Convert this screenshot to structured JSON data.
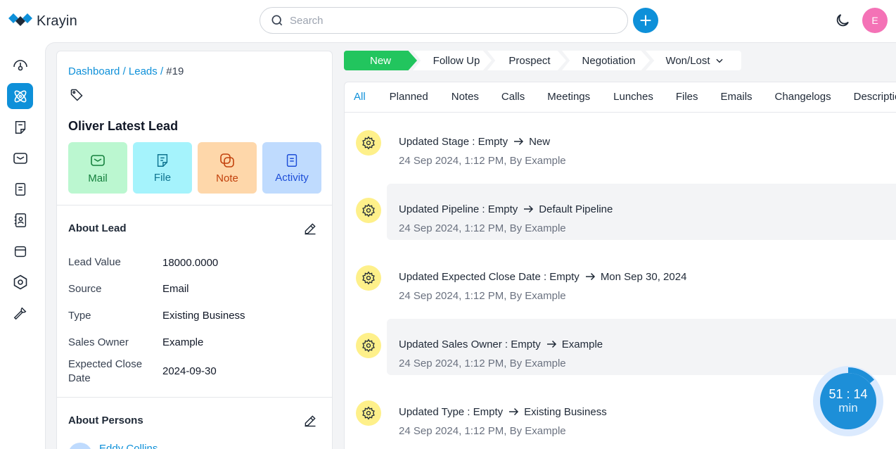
{
  "app": {
    "name": "Krayin"
  },
  "search": {
    "placeholder": "Search"
  },
  "user": {
    "avatar_initial": "E"
  },
  "sidebar": {
    "items": [
      {
        "name": "dashboard",
        "icon": "gauge-icon",
        "active": false
      },
      {
        "name": "leads",
        "icon": "atom-icon",
        "active": true
      },
      {
        "name": "quotes",
        "icon": "sticky-note-icon",
        "active": false
      },
      {
        "name": "mail",
        "icon": "mail-icon",
        "active": false
      },
      {
        "name": "activities",
        "icon": "clipboard-icon",
        "active": false
      },
      {
        "name": "contacts",
        "icon": "contact-book-icon",
        "active": false
      },
      {
        "name": "products",
        "icon": "archive-box-icon",
        "active": false
      },
      {
        "name": "settings",
        "icon": "settings-hexagon-icon",
        "active": false
      },
      {
        "name": "configuration",
        "icon": "wrench-icon",
        "active": false
      }
    ]
  },
  "breadcrumb": {
    "dashboard": "Dashboard",
    "leads": "Leads",
    "sep": "/",
    "current": "#19"
  },
  "lead": {
    "title": "Oliver Latest Lead"
  },
  "actions": {
    "mail": "Mail",
    "file": "File",
    "note": "Note",
    "activity": "Activity"
  },
  "about_lead": {
    "title": "About Lead",
    "fields": [
      {
        "label": "Lead Value",
        "value": "18000.0000"
      },
      {
        "label": "Source",
        "value": "Email"
      },
      {
        "label": "Type",
        "value": "Existing Business"
      },
      {
        "label": "Sales Owner",
        "value": "Example"
      },
      {
        "label": "Expected Close Date",
        "value": "2024-09-30"
      }
    ]
  },
  "about_persons": {
    "title": "About Persons",
    "person_name": "Eddy Collins"
  },
  "stages": {
    "new": "New",
    "follow_up": "Follow Up",
    "prospect": "Prospect",
    "negotiation": "Negotiation",
    "won_lost": "Won/Lost"
  },
  "tabs": [
    "All",
    "Planned",
    "Notes",
    "Calls",
    "Meetings",
    "Lunches",
    "Files",
    "Emails",
    "Changelogs",
    "Description"
  ],
  "entries": [
    {
      "title": "Updated Stage : Empty",
      "to": "New",
      "meta": "24 Sep 2024, 1:12 PM, By Example"
    },
    {
      "title": "Updated Pipeline : Empty",
      "to": "Default Pipeline",
      "meta": "24 Sep 2024, 1:12 PM, By Example"
    },
    {
      "title": "Updated Expected Close Date : Empty",
      "to": "Mon Sep 30, 2024",
      "meta": "24 Sep 2024, 1:12 PM, By Example"
    },
    {
      "title": "Updated Sales Owner : Empty",
      "to": "Example",
      "meta": "24 Sep 2024, 1:12 PM, By Example"
    },
    {
      "title": "Updated Type : Empty",
      "to": "Existing Business",
      "meta": "24 Sep 2024, 1:12 PM, By Example"
    }
  ],
  "timer": {
    "time": "51 : 14",
    "unit": "min"
  },
  "colors": {
    "accent": "#0e90d9",
    "stage_new": "#22c55e",
    "entry_icon_bg": "#fef08a"
  }
}
